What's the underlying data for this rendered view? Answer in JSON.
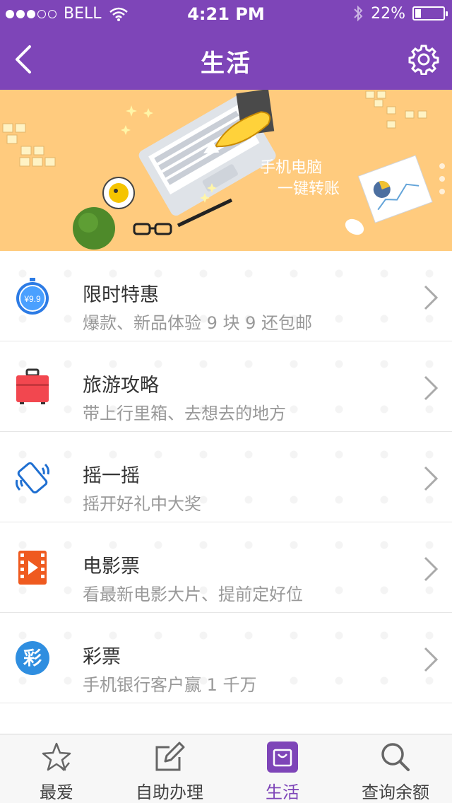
{
  "status_bar": {
    "carrier": "BELL",
    "time": "4:21 PM",
    "battery": "22%",
    "battery_level": 0.22
  },
  "nav": {
    "title": "生活",
    "back_icon": "chevron-left-icon",
    "settings_icon": "gear-icon"
  },
  "banner": {
    "line1": "手机电脑",
    "line2": "一键转账",
    "background": "#ffcb7e"
  },
  "items": [
    {
      "title": "限时特惠",
      "subtitle": "爆款、新品体验 9 块 9 还包邮",
      "icon": "stopwatch-price-icon",
      "icon_text": "¥9.9"
    },
    {
      "title": "旅游攻略",
      "subtitle": "带上行里箱、去想去的地方",
      "icon": "suitcase-icon"
    },
    {
      "title": "摇一摇",
      "subtitle": "摇开好礼中大奖",
      "icon": "shake-phone-icon"
    },
    {
      "title": "电影票",
      "subtitle": "看最新电影大片、提前定好位",
      "icon": "film-icon"
    },
    {
      "title": "彩票",
      "subtitle": "手机银行客户赢 1 千万",
      "icon": "lottery-icon",
      "icon_text": "彩"
    }
  ],
  "tabs": [
    {
      "label": "最爱",
      "icon": "star-icon",
      "active": false
    },
    {
      "label": "自助办理",
      "icon": "edit-icon",
      "active": false
    },
    {
      "label": "生活",
      "icon": "bag-icon",
      "active": true
    },
    {
      "label": "查询余额",
      "icon": "search-icon",
      "active": false
    }
  ],
  "colors": {
    "primary": "#7e45b8",
    "banner": "#ffcb7e",
    "text": "#333333",
    "subtext": "#999999"
  }
}
